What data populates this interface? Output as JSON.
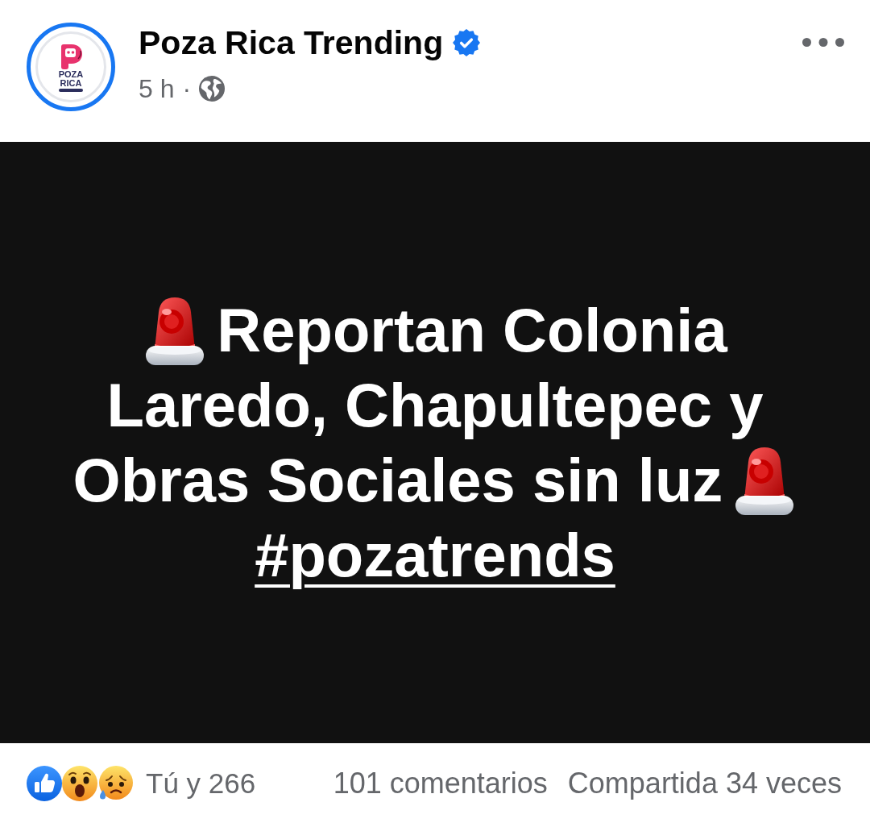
{
  "post": {
    "author": {
      "name": "Poza Rica Trending",
      "verified": true,
      "avatar_logo_text": "POZA RICA"
    },
    "time": "5 h",
    "separator": "·",
    "body": {
      "lines": [
        {
          "text": "Reportan Colonia",
          "siren_before": true,
          "siren_after": false
        },
        {
          "text": "Laredo, Chapultepec y",
          "siren_before": false,
          "siren_after": false
        },
        {
          "text": "Obras Sociales sin luz",
          "siren_before": false,
          "siren_after": true
        }
      ],
      "hashtag": "#pozatrends"
    },
    "footer": {
      "reactions": [
        {
          "kind": "like"
        },
        {
          "kind": "wow"
        },
        {
          "kind": "sad"
        }
      ],
      "reaction_summary": "Tú y 266",
      "comments": "101 comentarios",
      "shares": "Compartida 34 veces"
    }
  }
}
